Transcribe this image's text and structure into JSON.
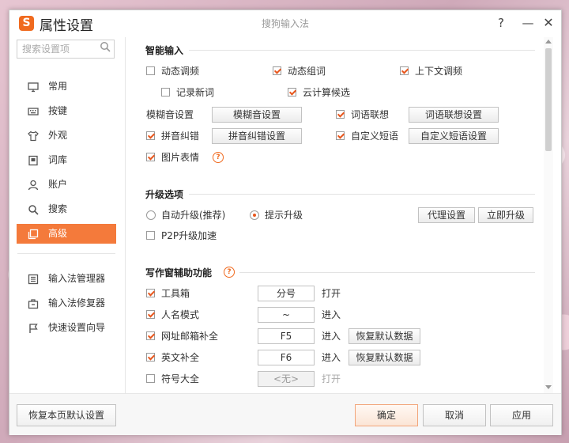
{
  "colors": {
    "accent": "#f47a3b",
    "check": "#e8571e",
    "window_bg": "#ffffff"
  },
  "titlebar": {
    "logo": "S",
    "title": "属性设置",
    "app_name": "搜狗输入法",
    "help": "?",
    "minimize": "—",
    "close": "✕"
  },
  "sidebar": {
    "search_placeholder": "搜索设置项",
    "items": [
      {
        "label": "常用",
        "icon": "monitor-icon"
      },
      {
        "label": "按键",
        "icon": "keyboard-icon"
      },
      {
        "label": "外观",
        "icon": "shirt-icon"
      },
      {
        "label": "词库",
        "icon": "book-icon"
      },
      {
        "label": "账户",
        "icon": "user-icon"
      },
      {
        "label": "搜索",
        "icon": "search-icon"
      },
      {
        "label": "高级",
        "icon": "advanced-icon",
        "active": true
      }
    ],
    "tools": [
      {
        "label": "输入法管理器",
        "icon": "manager-icon"
      },
      {
        "label": "输入法修复器",
        "icon": "repair-icon"
      },
      {
        "label": "快速设置向导",
        "icon": "flag-icon"
      }
    ]
  },
  "smart_input": {
    "title": "智能输入",
    "dynamic_freq": {
      "label": "动态调频",
      "checked": false
    },
    "dynamic_group": {
      "label": "动态组词",
      "checked": true
    },
    "context_freq": {
      "label": "上下文调频",
      "checked": true
    },
    "record_new": {
      "label": "记录新词",
      "checked": false
    },
    "cloud_candidates": {
      "label": "云计算候选",
      "checked": true
    },
    "fuzzy_label": "模糊音设置",
    "fuzzy_button": "模糊音设置",
    "word_assoc": {
      "label": "词语联想",
      "checked": true
    },
    "word_assoc_button": "词语联想设置",
    "pinyin_correct": {
      "label": "拼音纠错",
      "checked": true
    },
    "pinyin_correct_button": "拼音纠错设置",
    "custom_phrase": {
      "label": "自定义短语",
      "checked": true
    },
    "custom_phrase_button": "自定义短语设置",
    "image_emoji": {
      "label": "图片表情",
      "checked": true
    }
  },
  "upgrade": {
    "title": "升级选项",
    "auto_upgrade": {
      "label": "自动升级(推荐)",
      "selected": false
    },
    "prompt_upgrade": {
      "label": "提示升级",
      "selected": true
    },
    "proxy_button": "代理设置",
    "upgrade_now_button": "立即升级",
    "p2p": {
      "label": "P2P升级加速",
      "checked": false
    }
  },
  "writing_assist": {
    "title": "写作窗辅助功能",
    "rows": [
      {
        "label": "工具箱",
        "checked": true,
        "key": "分号",
        "action": "打开",
        "reset": null,
        "disabled": false
      },
      {
        "label": "人名模式",
        "checked": true,
        "key": "~",
        "action": "进入",
        "reset": null,
        "disabled": false
      },
      {
        "label": "网址邮箱补全",
        "checked": true,
        "key": "F5",
        "action": "进入",
        "reset": "恢复默认数据",
        "disabled": false
      },
      {
        "label": "英文补全",
        "checked": true,
        "key": "F6",
        "action": "进入",
        "reset": "恢复默认数据",
        "disabled": false
      },
      {
        "label": "符号大全",
        "checked": false,
        "key": "<无>",
        "action": "打开",
        "reset": null,
        "disabled": true
      }
    ]
  },
  "footer": {
    "restore_defaults": "恢复本页默认设置",
    "ok": "确定",
    "cancel": "取消",
    "apply": "应用"
  }
}
